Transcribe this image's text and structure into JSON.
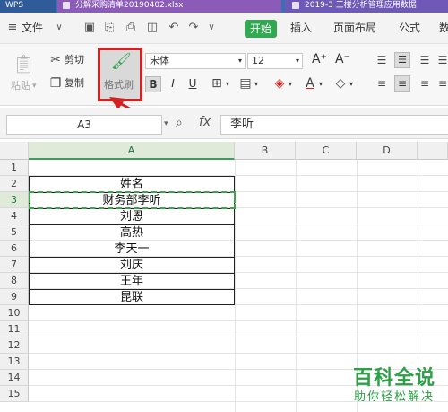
{
  "titlebar": {
    "tabs": [
      {
        "label": "WPS"
      },
      {
        "label": "分解采购清单20190402.xlsx"
      },
      {
        "label": "2019-3 三楼分析管理应用数据"
      }
    ]
  },
  "menubar": {
    "file_label": "文件",
    "tabs": [
      {
        "label": "开始"
      },
      {
        "label": "插入"
      },
      {
        "label": "页面布局"
      },
      {
        "label": "公式"
      },
      {
        "label": "数"
      }
    ]
  },
  "ribbon": {
    "paste_label": "粘贴",
    "cut_label": "剪切",
    "copy_label": "复制",
    "format_painter_label": "格式刷",
    "font_name": "宋体",
    "font_size": "12",
    "bold_label": "B",
    "italic_label": "I",
    "underline_label": "U",
    "grow_font": "A⁺",
    "shrink_font": "A⁻",
    "font_color_label": "A"
  },
  "formula_bar": {
    "name_box": "A3",
    "fx_label": "fx",
    "formula_value": "李听"
  },
  "sheet": {
    "columns": [
      "A",
      "B",
      "C",
      "D"
    ],
    "rows": [
      "1",
      "2",
      "3",
      "4",
      "5",
      "6",
      "7",
      "8",
      "9",
      "10",
      "11",
      "12",
      "13",
      "14",
      "15"
    ],
    "cells_A": [
      "姓名",
      "财务部李听",
      "刘恩",
      "高热",
      "李天一",
      "刘庆",
      "王年",
      "昆联"
    ]
  },
  "watermark": {
    "title": "百科全说",
    "subtitle": "助你轻松解决"
  },
  "colors": {
    "accent_green": "#32a852",
    "title_bar_blue": "#3d6fb5",
    "highlight_red": "#d32020"
  }
}
